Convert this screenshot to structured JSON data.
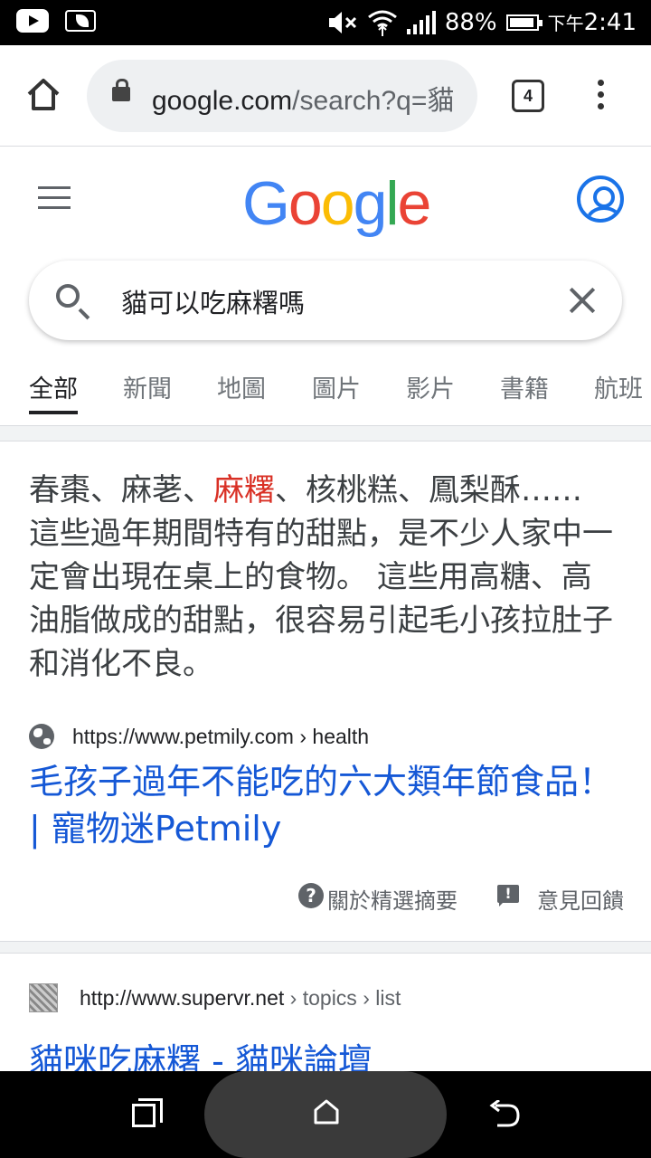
{
  "status_bar": {
    "battery": "88%",
    "time_prefix": "下午",
    "time": "2:41",
    "icons": [
      "youtube-icon",
      "leaf-notification-icon",
      "mute-icon",
      "wifi-icon",
      "signal-icon",
      "battery-icon"
    ]
  },
  "browser": {
    "url_domain": "google.com",
    "url_path": "/search?q=貓",
    "tab_count": "4",
    "icons": [
      "home-icon",
      "lock-icon",
      "menu-kebab-icon"
    ]
  },
  "google": {
    "logo_letters": [
      "G",
      "o",
      "o",
      "g",
      "l",
      "e"
    ],
    "logo_colors": [
      "#4285F4",
      "#EA4335",
      "#FBBC05",
      "#4285F4",
      "#34A853",
      "#EA4335"
    ],
    "search_query": "貓可以吃麻糬嗎",
    "tabs": [
      "全部",
      "新聞",
      "地圖",
      "圖片",
      "影片",
      "書籍",
      "航班"
    ],
    "active_tab": "全部"
  },
  "featured_snippet": {
    "text_before": "春棗、麻荖、",
    "highlight": "麻糬",
    "text_after": "、核桃糕、鳳梨酥…… 這些過年期間特有的甜點，是不少人家中一定會出現在桌上的食物。 這些用高糖、高油脂做成的甜點，很容易引起毛小孩拉肚子和消化不良。",
    "source_url": "https://www.petmily.com › health",
    "title": "毛孩子過年不能吃的六大類年節食品！ | 寵物迷Petmily",
    "about_label": "關於精選摘要",
    "feedback_label": "意見回饋"
  },
  "result2": {
    "url_domain": "http://www.supervr.net",
    "url_breadcrumb": " › topics › list",
    "title": "貓咪吃麻糬 - 貓咪論壇"
  },
  "colors": {
    "link": "#1558d6",
    "highlight": "#d93025",
    "account_blue": "#1a73e8"
  }
}
